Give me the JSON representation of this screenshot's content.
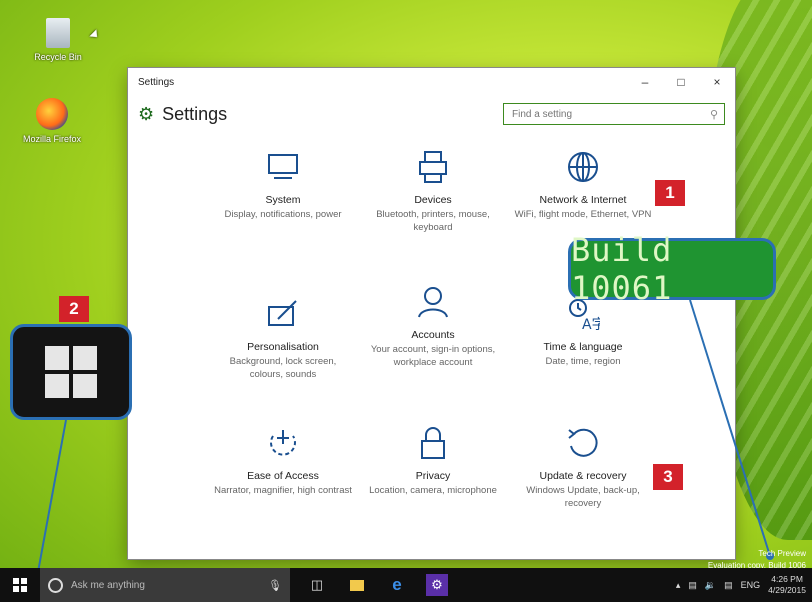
{
  "desktop": {
    "icons": [
      {
        "label": "Recycle Bin"
      },
      {
        "label": "Mozilla Firefox"
      }
    ]
  },
  "window": {
    "title": "Settings",
    "controls": {
      "minimize": "–",
      "maximize": "□",
      "close": "×"
    }
  },
  "header": {
    "title": "Settings",
    "search_placeholder": "Find a setting"
  },
  "tiles": [
    {
      "name": "System",
      "desc": "Display, notifications, power",
      "icon": "monitor-icon"
    },
    {
      "name": "Devices",
      "desc": "Bluetooth, printers, mouse, keyboard",
      "icon": "devices-icon"
    },
    {
      "name": "Network & Internet",
      "desc": "WiFi, flight mode, Ethernet, VPN",
      "icon": "globe-icon"
    },
    {
      "name": "Personalisation",
      "desc": "Background, lock screen, colours, sounds",
      "icon": "paint-icon"
    },
    {
      "name": "Accounts",
      "desc": "Your account, sign-in options, workplace account",
      "icon": "person-icon"
    },
    {
      "name": "Time & language",
      "desc": "Date, time, region",
      "icon": "time-language-icon"
    },
    {
      "name": "Ease of Access",
      "desc": "Narrator, magnifier, high contrast",
      "icon": "ease-icon"
    },
    {
      "name": "Privacy",
      "desc": "Location, camera, microphone",
      "icon": "lock-icon"
    },
    {
      "name": "Update & recovery",
      "desc": "Windows Update, back-up, recovery",
      "icon": "refresh-icon"
    }
  ],
  "annotations": {
    "badge1": "1",
    "badge2": "2",
    "badge3": "3",
    "build": "Build 10061"
  },
  "watermark": {
    "line1": "Tech Preview",
    "line2": "Evaluation copy. Build 1006"
  },
  "taskbar": {
    "search_placeholder": "Ask me anything",
    "lang": "ENG",
    "time": "4:26 PM",
    "date": "4/29/2015"
  },
  "colors": {
    "accent_green": "#3d8a1f",
    "badge_red": "#d3222a",
    "callout_blue": "#2b6fb3"
  }
}
